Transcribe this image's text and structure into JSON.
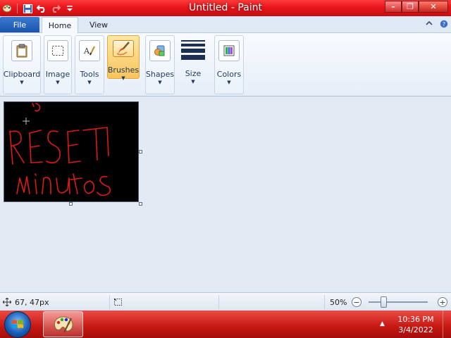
{
  "window": {
    "title": "Untitled - Paint",
    "controls": {
      "minimize": "–",
      "maximize": "❐",
      "close": "✕"
    }
  },
  "ribbon": {
    "tabs": [
      {
        "label": "File"
      },
      {
        "label": "Home",
        "selected": true
      },
      {
        "label": "View"
      }
    ],
    "groups": [
      {
        "label": "Clipboard",
        "icon": "clipboard-icon"
      },
      {
        "label": "Image",
        "icon": "select-icon"
      },
      {
        "label": "Tools",
        "icon": "text-tool-icon"
      },
      {
        "label": "Brushes",
        "icon": "brush-icon",
        "active": true
      },
      {
        "label": "Shapes",
        "icon": "shapes-icon"
      },
      {
        "label": "Size",
        "icon": "line-size-icon"
      },
      {
        "label": "Colors",
        "icon": "palette-icon"
      }
    ]
  },
  "canvas": {
    "background": "#000000",
    "drawing_text": [
      "RESET",
      "minutos"
    ],
    "ink_color": "#e01818"
  },
  "statusbar": {
    "cursor_position": "67, 47px",
    "zoom_label": "50%",
    "zoom_level": 0.5
  },
  "taskbar": {
    "time": "10:36 PM",
    "date": "3/4/2022"
  },
  "colors": {
    "accent": "#e8161b",
    "ribbon_active": "#f7c45c",
    "file_tab": "#1c55ad"
  }
}
